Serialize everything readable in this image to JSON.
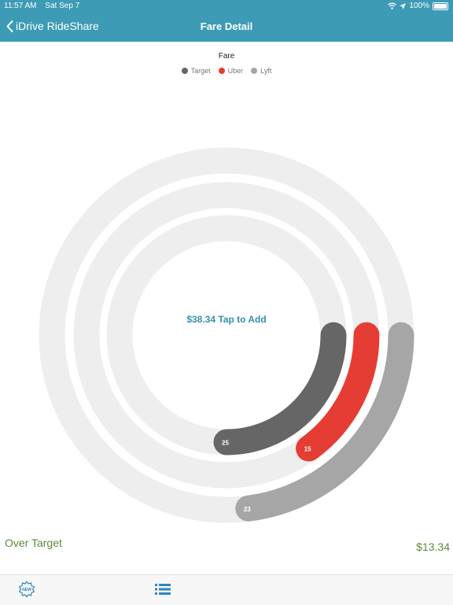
{
  "status": {
    "time": "11:57 AM",
    "date": "Sat Sep 7",
    "battery": "100%"
  },
  "nav": {
    "back_label": "iDrive RideShare",
    "title": "Fare Detail"
  },
  "center_label": "$38.34 Tap to Add",
  "summary": {
    "label": "Over Target",
    "value": "$13.34"
  },
  "tabs": {
    "new_label": "NEW"
  },
  "colors": {
    "accent": "#3d9bb5",
    "target": "#666666",
    "uber": "#e53d33",
    "lyft": "#a6a6a6",
    "track": "#eeeeee",
    "positive": "#5d8a3c"
  },
  "chart_data": {
    "type": "radial-bar",
    "title": "Fare",
    "series": [
      {
        "name": "Target",
        "value": 25,
        "color": "#666666"
      },
      {
        "name": "Uber",
        "value": 15,
        "color": "#e53d33"
      },
      {
        "name": "Lyft",
        "value": 23,
        "color": "#a6a6a6"
      }
    ],
    "max": 100,
    "legend_position": "top-center"
  }
}
